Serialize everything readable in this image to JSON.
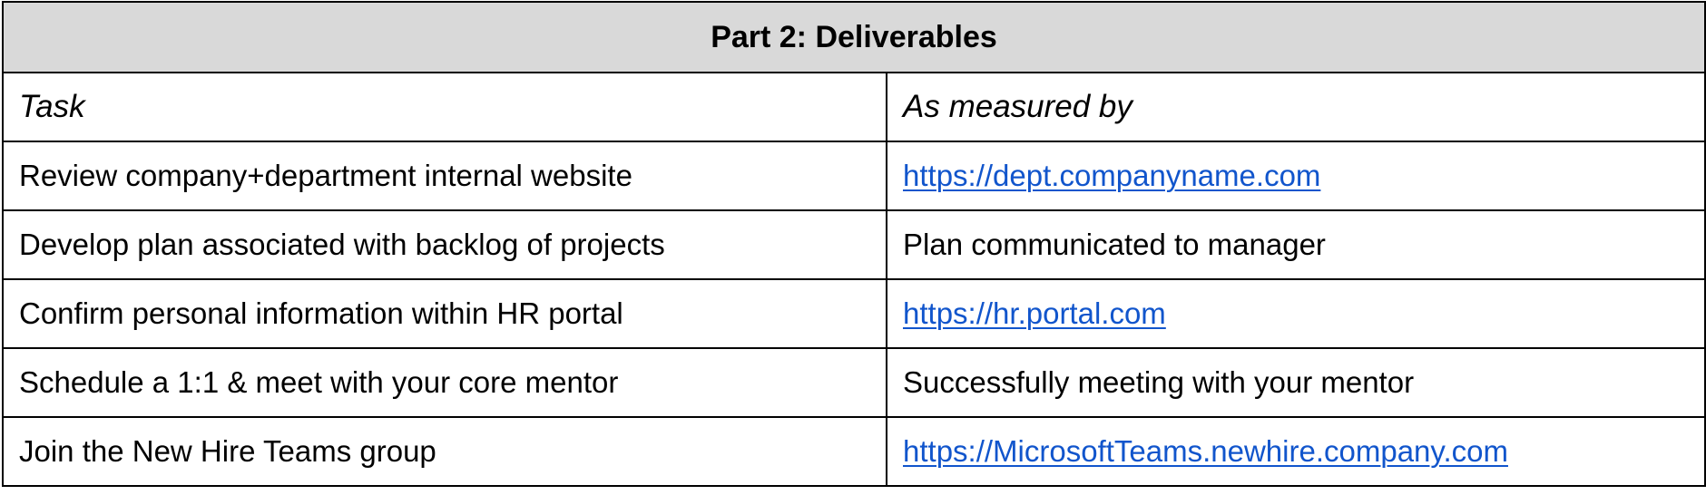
{
  "table": {
    "title": "Part 2: Deliverables",
    "headers": {
      "task": "Task",
      "measured_by": "As measured by"
    },
    "rows": [
      {
        "task": "Review company+department internal website",
        "measured_by": "https://dept.companyname.com",
        "is_link": true
      },
      {
        "task": "Develop plan associated with backlog of projects",
        "measured_by": "Plan communicated to manager",
        "is_link": false
      },
      {
        "task": "Confirm personal information within HR portal",
        "measured_by": "https://hr.portal.com",
        "is_link": true
      },
      {
        "task": "Schedule a 1:1 & meet with your core mentor",
        "measured_by": "Successfully meeting with your mentor",
        "is_link": false
      },
      {
        "task": "Join the New Hire Teams group",
        "measured_by": "https://MicrosoftTeams.newhire.company.com",
        "is_link": true
      }
    ]
  },
  "colors": {
    "header_background": "#d9d9d9",
    "link": "#1155cc",
    "border": "#000000"
  }
}
